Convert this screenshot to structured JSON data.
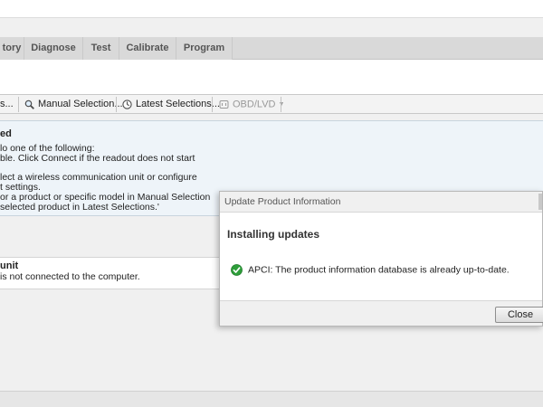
{
  "tabs": [
    {
      "label": "tory"
    },
    {
      "label": "Diagnose"
    },
    {
      "label": "Test"
    },
    {
      "label": "Calibrate"
    },
    {
      "label": "Program"
    }
  ],
  "toolbar": {
    "connect_partial": "s...",
    "manual_selection": "Manual Selection...",
    "latest_selections": "Latest Selections...",
    "obd_lvd": "OBD/LVD"
  },
  "panel_connect": {
    "title": "ed",
    "lines": [
      "lo one of the following:",
      "ble. Click Connect if the readout does not start",
      "lect a wireless communication unit or configure",
      "t settings.",
      "or a product or specific model in Manual Selection",
      " selected product in Latest Selections.'"
    ]
  },
  "panel_unit": {
    "title": " unit",
    "line": "is not connected to the computer."
  },
  "dialog": {
    "title": "Update Product Information",
    "heading": "Installing updates",
    "message": "APCI: The product information database is already up-to-date.",
    "close_label": "Close"
  },
  "colors": {
    "tab_bg": "#d9d9d9",
    "panel_bg": "#eef4f9",
    "success_green": "#2e9e3a"
  }
}
